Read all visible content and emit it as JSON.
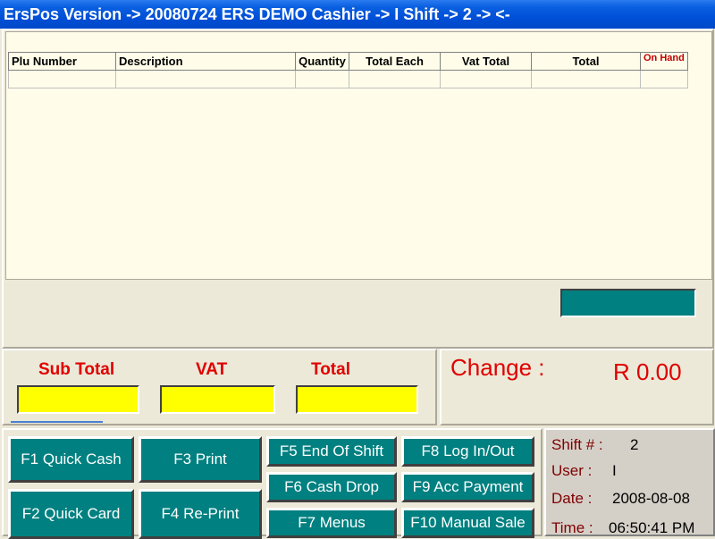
{
  "window": {
    "title": "ErsPos Version -> 20080724 ERS DEMO Cashier -> I Shift -> 2 ->  <-"
  },
  "grid": {
    "columns": [
      "Plu Number",
      "Description",
      "Quantity",
      "Total Each",
      "Vat Total",
      "Total",
      "On Hand"
    ]
  },
  "totals": {
    "subtotal_label": "Sub Total",
    "subtotal_value": "",
    "vat_label": "VAT",
    "vat_value": "",
    "total_label": "Total",
    "total_value": ""
  },
  "change": {
    "label": "Change :",
    "value": "R 0.00"
  },
  "buttons": {
    "f1": "F1   Quick Cash",
    "f2": "F2   Quick Card",
    "f3": "F3   Print",
    "f4": "F4   Re-Print",
    "f5": "F5  End Of Shift",
    "f6": "F6   Cash Drop",
    "f7": "F7   Menus",
    "f8": "F8   Log In/Out",
    "f9": "F9 Acc Payment",
    "f10": "F10 Manual Sale"
  },
  "info": {
    "shift_label": "Shift  # :",
    "shift_value": "2",
    "user_label": "User :",
    "user_value": "I",
    "date_label": "Date  :",
    "date_value": "2008-08-08",
    "time_label": "Time  :",
    "time_value": "06:50:41 PM"
  },
  "colors": {
    "accent": "#008080",
    "alert": "#e00000",
    "field": "#ffff00",
    "titlebar": "#0050d8"
  }
}
